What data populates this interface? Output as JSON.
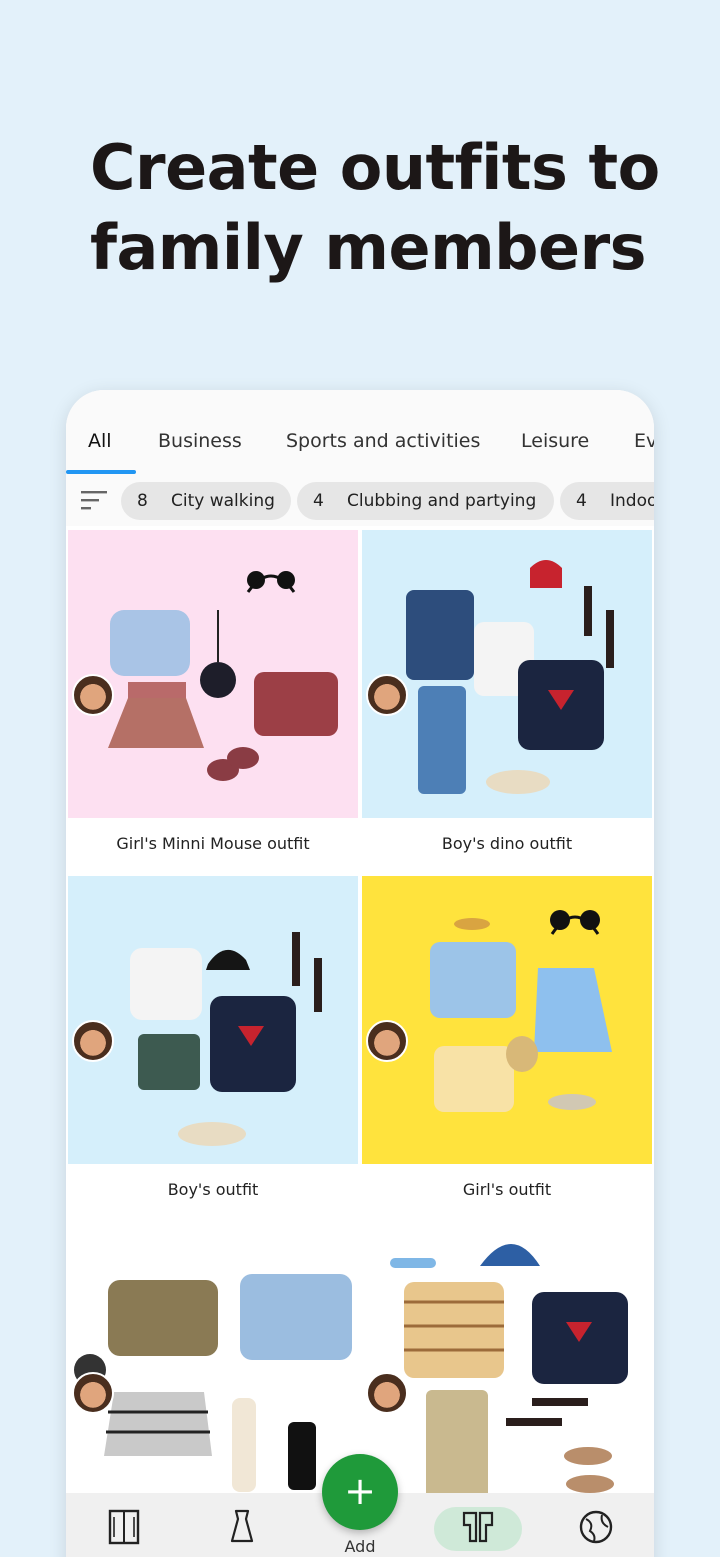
{
  "headline": "Create outfits to family members",
  "tabs": [
    {
      "label": "All"
    },
    {
      "label": "Business"
    },
    {
      "label": "Sports and activities"
    },
    {
      "label": "Leisure"
    },
    {
      "label": "Ev"
    }
  ],
  "chips": [
    {
      "count": "8",
      "label": "City walking"
    },
    {
      "count": "4",
      "label": "Clubbing and partying"
    },
    {
      "count": "4",
      "label": "Indoo"
    }
  ],
  "outfits": [
    {
      "title": "Girl's Minni Mouse outfit",
      "bg": "#fde0f1"
    },
    {
      "title": "Boy's dino outfit",
      "bg": "#d5effb"
    },
    {
      "title": "Boy's outfit",
      "bg": "#d5effb"
    },
    {
      "title": "Girl's outfit",
      "bg": "#ffe33d"
    },
    {
      "title": "",
      "bg": "#ffffff"
    },
    {
      "title": "",
      "bg": "#ffffff"
    }
  ],
  "fab": {
    "icon": "plus-icon",
    "label": "Add"
  },
  "colors": {
    "accent": "#2196f3",
    "fab": "#1f9a3a",
    "active_nav": "#cfe9d8"
  }
}
